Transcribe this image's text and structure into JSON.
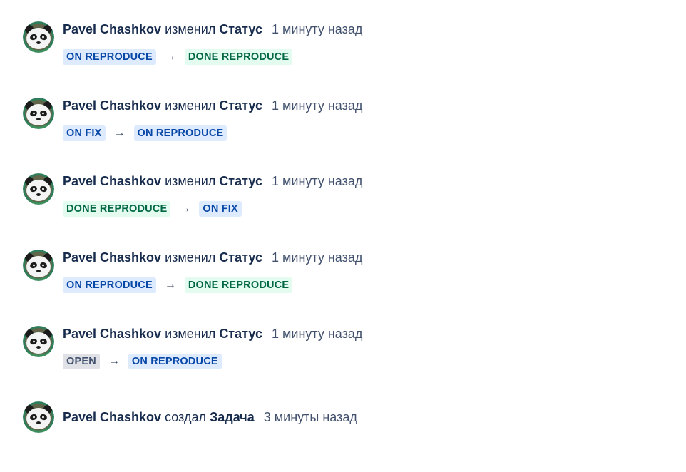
{
  "entries": [
    {
      "author": "Pavel Chashkov",
      "verb": "изменил",
      "field": "Статус",
      "time": "1 минуту назад",
      "from": {
        "label": "ON REPRODUCE",
        "color": "blue"
      },
      "to": {
        "label": "DONE REPRODUCE",
        "color": "green"
      }
    },
    {
      "author": "Pavel Chashkov",
      "verb": "изменил",
      "field": "Статус",
      "time": "1 минуту назад",
      "from": {
        "label": "ON FIX",
        "color": "blue"
      },
      "to": {
        "label": "ON REPRODUCE",
        "color": "blue"
      }
    },
    {
      "author": "Pavel Chashkov",
      "verb": "изменил",
      "field": "Статус",
      "time": "1 минуту назад",
      "from": {
        "label": "DONE REPRODUCE",
        "color": "green"
      },
      "to": {
        "label": "ON FIX",
        "color": "blue"
      }
    },
    {
      "author": "Pavel Chashkov",
      "verb": "изменил",
      "field": "Статус",
      "time": "1 минуту назад",
      "from": {
        "label": "ON REPRODUCE",
        "color": "blue"
      },
      "to": {
        "label": "DONE REPRODUCE",
        "color": "green"
      }
    },
    {
      "author": "Pavel Chashkov",
      "verb": "изменил",
      "field": "Статус",
      "time": "1 минуту назад",
      "from": {
        "label": "OPEN",
        "color": "grey"
      },
      "to": {
        "label": "ON REPRODUCE",
        "color": "blue"
      }
    },
    {
      "author": "Pavel Chashkov",
      "verb": "создал",
      "field": "Задача",
      "time": "3 минуты назад"
    }
  ],
  "arrow_glyph": "→",
  "avatar_icon": "panda-avatar-icon",
  "colors": {
    "blue_bg": "#deebff",
    "blue_text": "#0747a6",
    "green_bg": "#e3fcef",
    "green_text": "#006644",
    "grey_bg": "#dfe1e6",
    "grey_text": "#42526e"
  }
}
